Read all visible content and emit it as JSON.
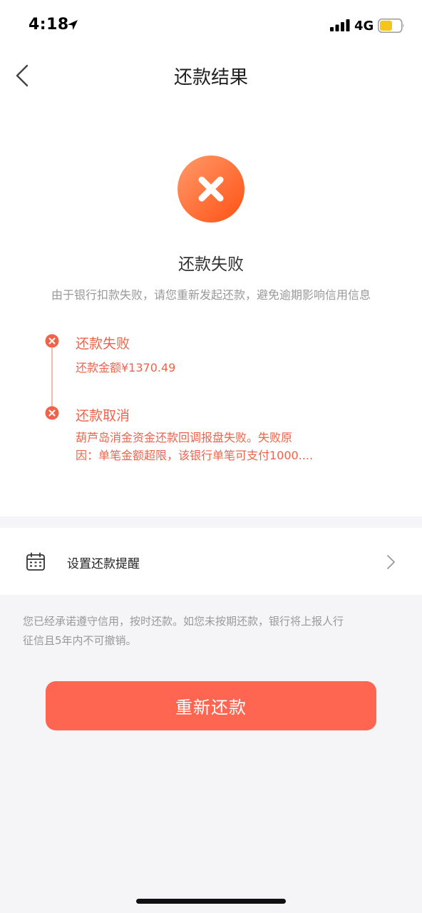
{
  "status_bar": {
    "time": "4:18",
    "network": "4G",
    "battery_color": "#f5c518"
  },
  "nav": {
    "title": "还款结果"
  },
  "result": {
    "title": "还款失败",
    "description": "由于银行扣款失败，请您重新发起还款，避免逾期影响信用信息",
    "icon_color": "#ff5f2e"
  },
  "timeline": [
    {
      "title": "还款失败",
      "lines": [
        "还款金额¥1370.49"
      ]
    },
    {
      "title": "还款取消",
      "lines": [
        "葫芦岛消金资金还款回调报盘失败。失败原",
        "因：单笔金额超限，该银行单笔可支付1000...."
      ]
    }
  ],
  "reminder": {
    "label": "设置还款提醒"
  },
  "notice": {
    "text_line1": "您已经承诺遵守信用，按时还款。如您未按期还款，银行将上报人行",
    "text_line2": "征信且5年内不可撤销。"
  },
  "retry_button": {
    "label": "重新还款",
    "color": "#ff6651"
  }
}
